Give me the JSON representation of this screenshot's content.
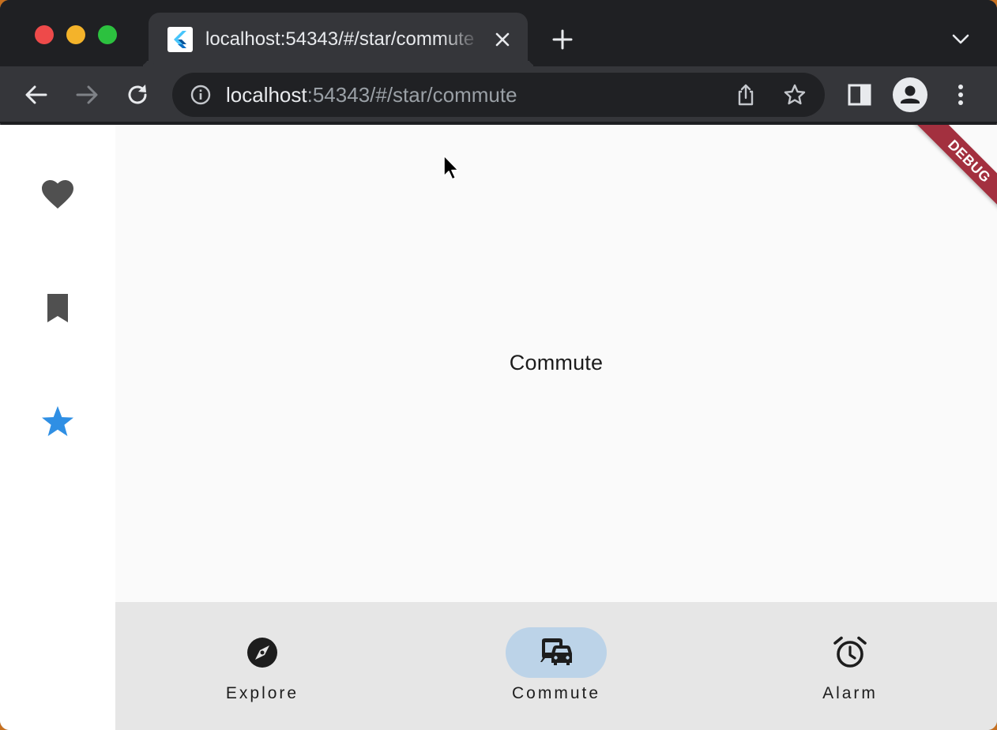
{
  "browser": {
    "tab": {
      "title": "localhost:54343/#/star/commute"
    },
    "address": {
      "host": "localhost",
      "path": ":54343/#/star/commute"
    }
  },
  "icons": {
    "back": "arrow-left-icon",
    "forward": "arrow-right-icon",
    "reload": "reload-icon",
    "site_info": "info-icon",
    "share": "share-icon",
    "bookmark_star": "star-outline-icon",
    "side_panel": "side-panel-icon",
    "profile": "person-icon",
    "menu": "kebab-menu-icon"
  },
  "app": {
    "rail": {
      "items": [
        {
          "icon": "heart-icon",
          "color": "#505050"
        },
        {
          "icon": "bookmark-icon",
          "color": "#505050"
        },
        {
          "icon": "star-icon",
          "color": "#2f8fe4",
          "selected": true
        }
      ]
    },
    "content": {
      "text": "Commute"
    },
    "bottom_nav": {
      "items": [
        {
          "label": "Explore",
          "icon": "explore-compass-icon"
        },
        {
          "label": "Commute",
          "icon": "commute-icon",
          "selected": true
        },
        {
          "label": "Alarm",
          "icon": "alarm-icon"
        }
      ]
    },
    "debug_banner": "DEBUG"
  },
  "colors": {
    "selected_star": "#2f8fe4",
    "nav_indicator": "#bcd3e8",
    "debug_banner": "#a3303f"
  }
}
